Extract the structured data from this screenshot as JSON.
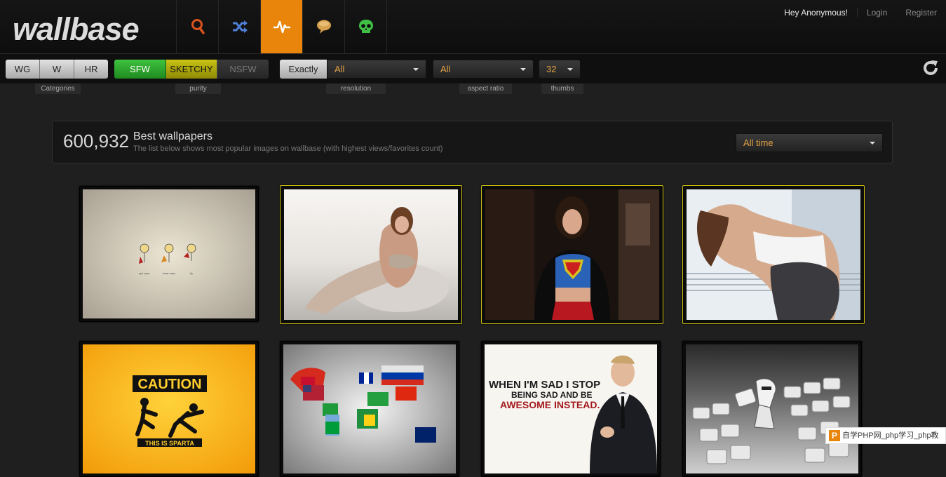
{
  "app": {
    "logo_text": "wallbase"
  },
  "nav": {
    "items": [
      {
        "icon": "search-icon",
        "color": "#d9531e"
      },
      {
        "icon": "random-icon",
        "color": "#4f7fd8"
      },
      {
        "icon": "pulse-icon",
        "color": "#ffffff",
        "active": true
      },
      {
        "icon": "chat-bubble-icon",
        "color": "#d7a24e"
      },
      {
        "icon": "skull-icon",
        "color": "#3fbf45"
      }
    ]
  },
  "user": {
    "greeting": "Hey Anonymous!",
    "login": "Login",
    "register": "Register"
  },
  "filters": {
    "categories": [
      "WG",
      "W",
      "HR"
    ],
    "categories_label": "Categories",
    "purity": [
      "SFW",
      "SKETCHY",
      "NSFW"
    ],
    "purity_label": "purity",
    "resolution_mode": "Exactly",
    "resolution_value": "All",
    "resolution_label": "resolution",
    "aspect_value": "All",
    "aspect_label": "aspect ratio",
    "thumbs_value": "32",
    "thumbs_label": "thumbs"
  },
  "info": {
    "count": "600,932",
    "title": "Best wallpapers",
    "description": "The list below shows most popular images on wallbase (with highest views/favorites count)",
    "time_filter": "All time"
  },
  "thumbs": [
    {
      "subject": "cartoon-figures",
      "favorited": false,
      "caption_1": "got cape",
      "caption_2": "wear cape",
      "caption_3": "fly"
    },
    {
      "subject": "woman-on-carpet",
      "favorited": true
    },
    {
      "subject": "woman-superman-shirt",
      "favorited": true
    },
    {
      "subject": "woman-by-window",
      "favorited": true
    },
    {
      "subject": "caution-sign",
      "favorited": false,
      "caption_1": "CAUTION",
      "caption_2": "THIS IS SPARTA"
    },
    {
      "subject": "world-flag-map",
      "favorited": false
    },
    {
      "subject": "man-in-suit-quote",
      "favorited": false,
      "caption_1": "WHEN I'M SAD I STOP",
      "caption_2": "BEING SAD AND BE",
      "caption_3": "AWESOME INSTEAD."
    },
    {
      "subject": "keyboard-stormtrooper",
      "favorited": false
    }
  ],
  "watermark": {
    "mark": "P",
    "text": "自学PHP网_php学习_php教"
  }
}
